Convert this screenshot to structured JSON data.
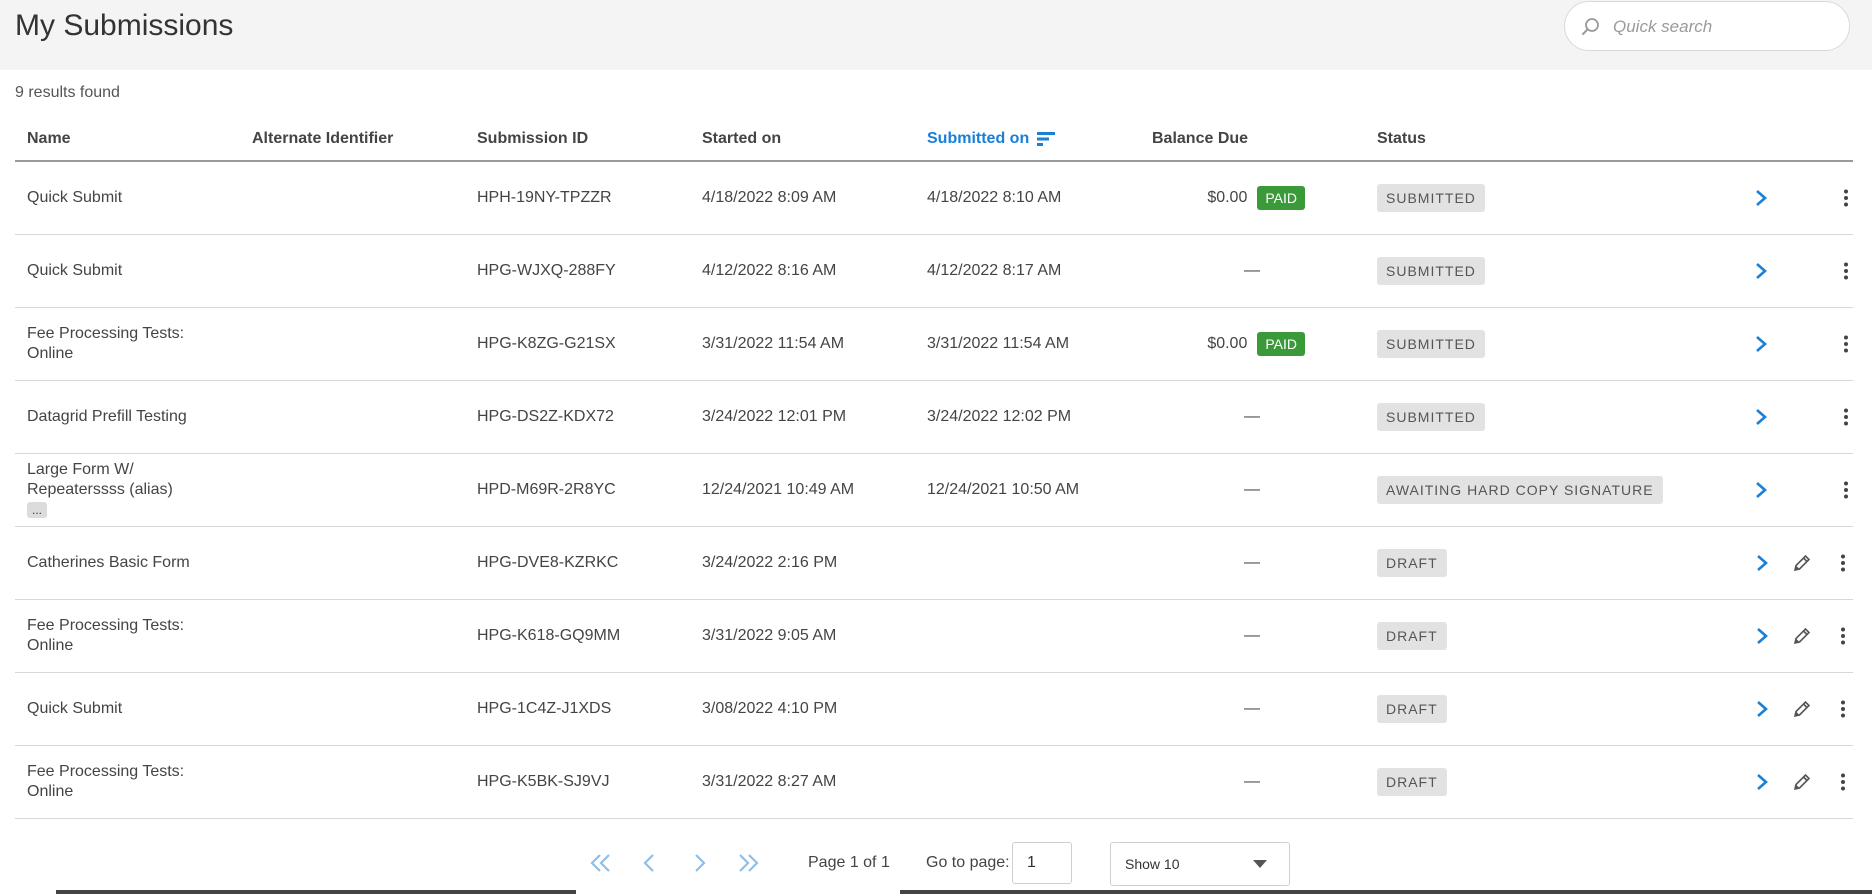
{
  "header": {
    "title": "My Submissions"
  },
  "search": {
    "placeholder": "Quick search",
    "icon": "search-icon"
  },
  "results": {
    "count_text": "9 results found"
  },
  "columns": {
    "name": "Name",
    "alt_id": "Alternate Identifier",
    "sub_id": "Submission ID",
    "started": "Started on",
    "submitted": "Submitted on",
    "balance": "Balance Due",
    "status": "Status"
  },
  "rows": [
    {
      "name": "Quick Submit",
      "alt_id": "",
      "sub_id": "HPH-19NY-TPZZR",
      "started": "4/18/2022 8:09 AM",
      "submitted": "4/18/2022 8:10 AM",
      "balance": "$0.00",
      "paid": "PAID",
      "status": "SUBMITTED"
    },
    {
      "name": "Quick Submit",
      "alt_id": "",
      "sub_id": "HPG-WJXQ-288FY",
      "started": "4/12/2022 8:16 AM",
      "submitted": "4/12/2022 8:17 AM",
      "balance": "—",
      "paid": "",
      "status": "SUBMITTED"
    },
    {
      "name": "Fee Processing Tests: Online",
      "alt_id": "",
      "sub_id": "HPG-K8ZG-G21SX",
      "started": "3/31/2022 11:54 AM",
      "submitted": "3/31/2022 11:54 AM",
      "balance": "$0.00",
      "paid": "PAID",
      "status": "SUBMITTED"
    },
    {
      "name": "Datagrid Prefill Testing",
      "alt_id": "",
      "sub_id": "HPG-DS2Z-KDX72",
      "started": "3/24/2022 12:01 PM",
      "submitted": "3/24/2022 12:02 PM",
      "balance": "—",
      "paid": "",
      "status": "SUBMITTED"
    },
    {
      "name": "Large Form W/ Repeaterssss (alias)",
      "name_more": "...",
      "alt_id": "",
      "sub_id": "HPD-M69R-2R8YC",
      "started": "12/24/2021 10:49 AM",
      "submitted": "12/24/2021 10:50 AM",
      "balance": "—",
      "paid": "",
      "status": "AWAITING HARD COPY SIGNATURE"
    },
    {
      "name": "Catherines Basic Form",
      "alt_id": "",
      "sub_id": "HPG-DVE8-KZRKC",
      "started": "3/24/2022 2:16 PM",
      "submitted": "",
      "balance": "—",
      "paid": "",
      "status": "DRAFT"
    },
    {
      "name": "Fee Processing Tests: Online",
      "alt_id": "",
      "sub_id": "HPG-K618-GQ9MM",
      "started": "3/31/2022 9:05 AM",
      "submitted": "",
      "balance": "—",
      "paid": "",
      "status": "DRAFT"
    },
    {
      "name": "Quick Submit",
      "alt_id": "",
      "sub_id": "HPG-1C4Z-J1XDS",
      "started": "3/08/2022 4:10 PM",
      "submitted": "",
      "balance": "—",
      "paid": "",
      "status": "DRAFT"
    },
    {
      "name": "Fee Processing Tests: Online",
      "alt_id": "",
      "sub_id": "HPG-K5BK-SJ9VJ",
      "started": "3/31/2022 8:27 AM",
      "submitted": "",
      "balance": "—",
      "paid": "",
      "status": "DRAFT"
    }
  ],
  "pagination": {
    "page_info": "Page 1 of 1",
    "goto_label": "Go to page:",
    "goto_value": "1",
    "show_selected": "Show 10"
  },
  "colors": {
    "accent": "#1a7fd6",
    "paid": "#3a9a3a",
    "status_bg": "#e2e2e2",
    "pager_arrow": "#8fbfe8"
  }
}
